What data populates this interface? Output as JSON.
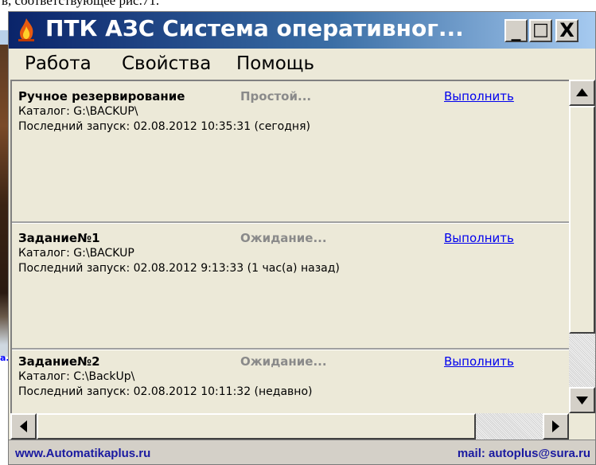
{
  "background": {
    "doc_fragment": "в, соответствующее рис.71."
  },
  "window": {
    "title": "ПТК АЗС Система оперативног...",
    "buttons": {
      "minimize": "_",
      "maximize": "□",
      "close": "X"
    }
  },
  "menu": {
    "items": [
      "Работа",
      "Свойства",
      "Помощь"
    ]
  },
  "tasks": [
    {
      "name": "Ручное резервирование",
      "status": "Простой...",
      "action": "Выполнить",
      "catalog": "Каталог: G:\\BACKUP\\",
      "last_run": "Последний запуск: 02.08.2012 10:35:31 (сегодня)"
    },
    {
      "name": "Задание№1",
      "status": "Ожидание...",
      "action": "Выполнить",
      "catalog": "Каталог: G:\\BACKUP",
      "last_run": "Последний запуск: 02.08.2012 9:13:33 (1 час(а) назад)"
    },
    {
      "name": "Задание№2",
      "status": "Ожидание...",
      "action": "Выполнить",
      "catalog": "Каталог: C:\\BackUp\\",
      "last_run": "Последний запуск: 02.08.2012 10:11:32 (недавно)"
    }
  ],
  "statusbar": {
    "website": "www.Automatikaplus.ru",
    "mail": "mail:  autoplus@sura.ru"
  },
  "colors": {
    "title_gradient_start": "#0a246a",
    "title_gradient_end": "#a6caf0",
    "link": "#0000ee",
    "status_gray": "#8a8a8a",
    "statusbar_text": "#1a1aa0"
  },
  "icons": [
    "flame-icon",
    "scroll-up-icon",
    "scroll-down-icon",
    "scroll-left-icon",
    "scroll-right-icon"
  ]
}
